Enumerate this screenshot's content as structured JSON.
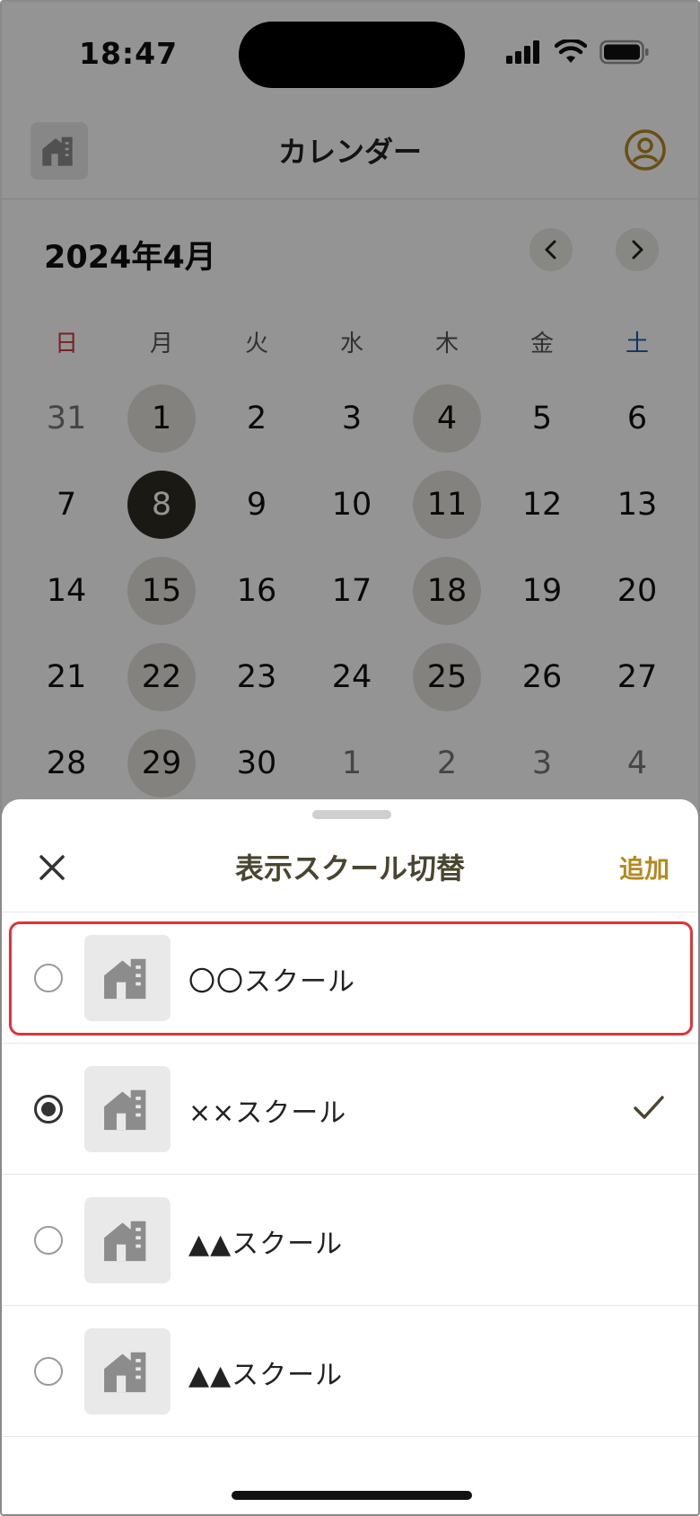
{
  "status_bar": {
    "time": "18:47",
    "icons": [
      "cellular-signal-icon",
      "wifi-icon",
      "battery-icon"
    ]
  },
  "navbar": {
    "title": "カレンダー",
    "left_icon": "school-building-icon",
    "right_icon": "account-circle-icon"
  },
  "calendar": {
    "month_label": "2024年4月",
    "prev_icon": "chevron-left-icon",
    "next_icon": "chevron-right-icon",
    "weekdays": [
      "日",
      "月",
      "火",
      "水",
      "木",
      "金",
      "土"
    ],
    "weeks": [
      [
        {
          "d": "31",
          "muted": true
        },
        {
          "d": "1",
          "event": true
        },
        {
          "d": "2"
        },
        {
          "d": "3"
        },
        {
          "d": "4",
          "event": true
        },
        {
          "d": "5"
        },
        {
          "d": "6"
        }
      ],
      [
        {
          "d": "7"
        },
        {
          "d": "8",
          "selected": true
        },
        {
          "d": "9"
        },
        {
          "d": "10"
        },
        {
          "d": "11",
          "event": true
        },
        {
          "d": "12"
        },
        {
          "d": "13"
        }
      ],
      [
        {
          "d": "14"
        },
        {
          "d": "15",
          "event": true
        },
        {
          "d": "16"
        },
        {
          "d": "17"
        },
        {
          "d": "18",
          "event": true
        },
        {
          "d": "19"
        },
        {
          "d": "20"
        }
      ],
      [
        {
          "d": "21"
        },
        {
          "d": "22",
          "event": true
        },
        {
          "d": "23"
        },
        {
          "d": "24"
        },
        {
          "d": "25",
          "event": true
        },
        {
          "d": "26"
        },
        {
          "d": "27"
        }
      ],
      [
        {
          "d": "28"
        },
        {
          "d": "29",
          "event": true
        },
        {
          "d": "30"
        },
        {
          "d": "1",
          "muted": true
        },
        {
          "d": "2",
          "muted": true
        },
        {
          "d": "3",
          "muted": true
        },
        {
          "d": "4",
          "muted": true
        }
      ]
    ]
  },
  "sheet": {
    "title": "表示スクール切替",
    "close_icon": "close-icon",
    "add_label": "追加",
    "schools": [
      {
        "name": "〇〇スクール",
        "selected": false,
        "highlighted": true
      },
      {
        "name": "××スクール",
        "selected": true,
        "highlighted": false
      },
      {
        "name": "▲▲スクール",
        "selected": false,
        "highlighted": false
      },
      {
        "name": "▲▲スクール",
        "selected": false,
        "highlighted": false
      }
    ],
    "check_icon": "checkmark-icon"
  },
  "colors": {
    "accent_gold": "#b48a1e",
    "selected_day": "#2e2b22",
    "event_day": "#e4e1d9",
    "sunday": "#d03a3a",
    "saturday": "#1f5aa6",
    "highlight_border": "#e2313b"
  }
}
